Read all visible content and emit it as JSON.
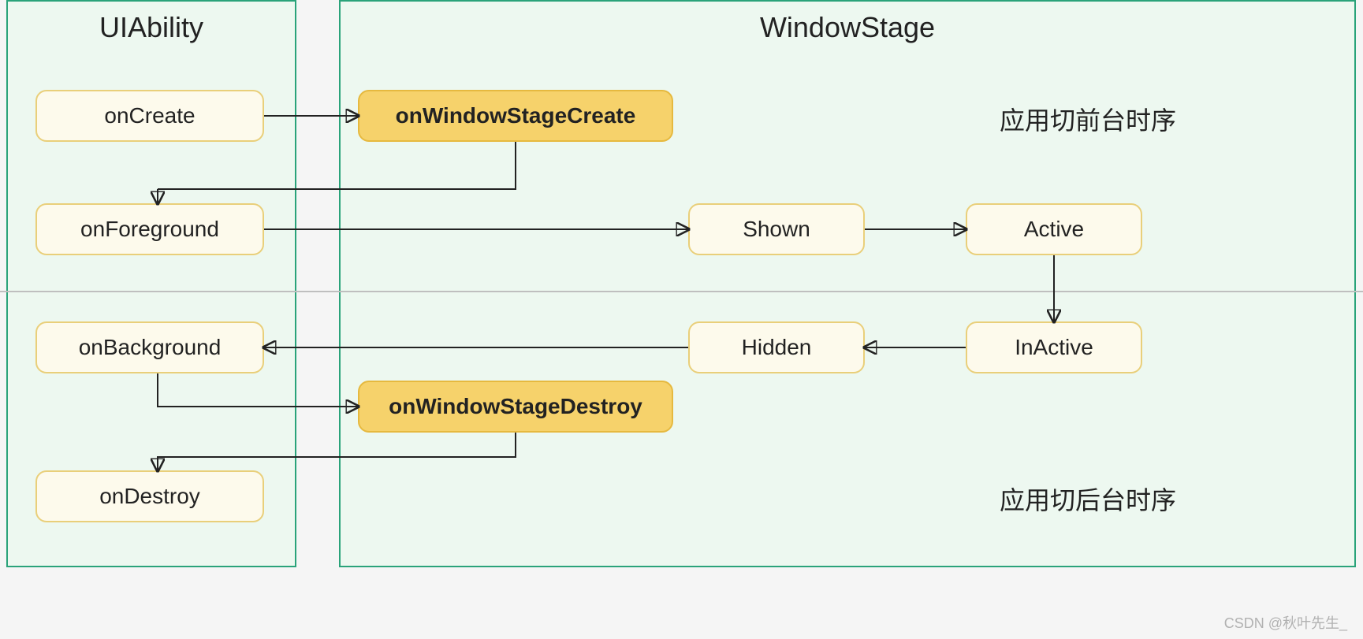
{
  "panels": {
    "left_title": "UIAbility",
    "right_title": "WindowStage"
  },
  "labels": {
    "foreground_sequence": "应用切前台时序",
    "background_sequence": "应用切后台时序"
  },
  "nodes": {
    "onCreate": "onCreate",
    "onWindowStageCreate": "onWindowStageCreate",
    "onForeground": "onForeground",
    "shown": "Shown",
    "active": "Active",
    "onBackground": "onBackground",
    "hidden": "Hidden",
    "inactive": "InActive",
    "onWindowStageDestroy": "onWindowStageDestroy",
    "onDestroy": "onDestroy"
  },
  "watermark": "CSDN @秋叶先生_",
  "colors": {
    "panel_border": "#2aa37a",
    "panel_fill": "#edf8f0",
    "node_border": "#e9cf7a",
    "node_fill": "#fdfaec",
    "highlight_fill": "#f6d26b"
  }
}
